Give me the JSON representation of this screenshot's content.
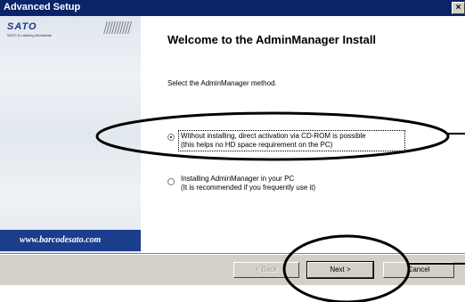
{
  "window": {
    "title": "Advanced Setup",
    "close_glyph": "×"
  },
  "sidebar": {
    "logo": "SATO",
    "tagline": "SATO & Labeling Worldwide",
    "website": "www.barcodesato.com"
  },
  "main": {
    "heading": "Welcome to the AdminManager Install",
    "prompt": "Select the AdminManager method.",
    "options": [
      {
        "line1": "Without installing, direct activation via CD-ROM is possible",
        "line2": "(this helps no HD space requirement on the PC)",
        "selected": true
      },
      {
        "line1": "Installing AdminManager in your PC",
        "line2": "(It is recommended if you frequently use it)",
        "selected": false
      }
    ]
  },
  "buttons": {
    "back": "< Back",
    "next": "Next >",
    "cancel": "Cancel"
  },
  "colors": {
    "titlebar": "#0a246a",
    "sidebar_band": "#1c3c8c",
    "annotation": "#000000"
  }
}
